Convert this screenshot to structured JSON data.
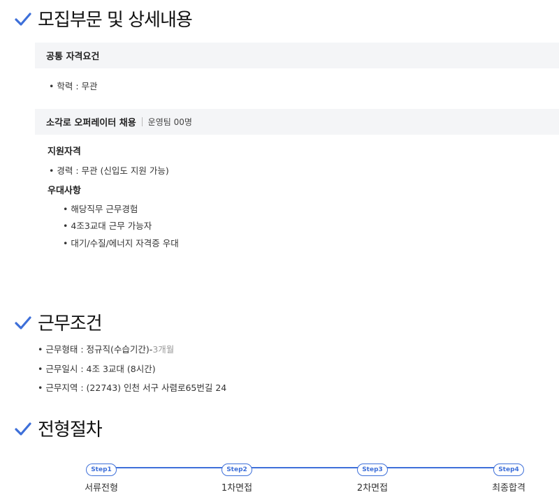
{
  "recruit": {
    "title": "모집부문 및 상세내용",
    "common": {
      "heading": "공통 자격요건",
      "items": [
        "학력 : 무관"
      ]
    },
    "position": {
      "heading": "소각로 오퍼레이터 채용",
      "team": "운영팀 00명",
      "qual_heading": "지원자격",
      "qual_items": [
        "경력 : 무관 (신입도 지원 가능)"
      ],
      "pref_heading": "우대사항",
      "pref_items": [
        "해당직무 근무경험",
        "4조3교대 근무 가능자",
        "대기/수질/에너지 자격증 우대"
      ]
    }
  },
  "conditions": {
    "title": "근무조건",
    "items": [
      {
        "text": "근무형태 : 정규직(수습기간)-",
        "muted": "3개월"
      },
      {
        "text": "근무일시 : 4조 3교대 (8시간)"
      },
      {
        "text": "근무지역 : (22743) 인천 서구 사렴로65번길 24"
      }
    ]
  },
  "process": {
    "title": "전형절차",
    "steps": [
      {
        "step": "Step1",
        "label": "서류전형"
      },
      {
        "step": "Step2",
        "label": "1차면접"
      },
      {
        "step": "Step3",
        "label": "2차면접"
      },
      {
        "step": "Step4",
        "label": "최종합격"
      }
    ]
  },
  "colors": {
    "accent": "#3d6fd9",
    "bar_bg": "#f4f5f7"
  }
}
